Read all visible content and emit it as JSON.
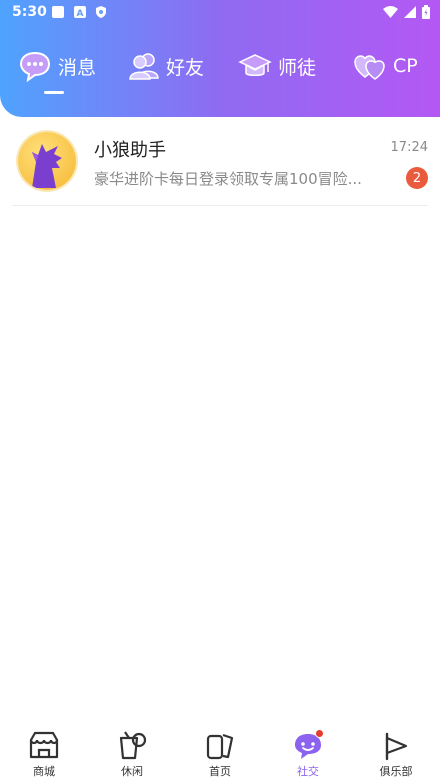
{
  "status_bar": {
    "time": "5:30"
  },
  "top_tabs": [
    {
      "label": "消息",
      "icon": "chat-bubble-icon",
      "active": true
    },
    {
      "label": "好友",
      "icon": "friends-icon",
      "active": false
    },
    {
      "label": "师徒",
      "icon": "graduation-cap-icon",
      "active": false
    },
    {
      "label": "CP",
      "icon": "hearts-icon",
      "active": false
    }
  ],
  "messages": [
    {
      "name": "小狼助手",
      "time": "17:24",
      "preview": "豪华进阶卡每日登录领取专属100冒险...",
      "unread": "2",
      "avatar_icon": "wolf-icon"
    }
  ],
  "bottom_nav": [
    {
      "label": "商城",
      "icon": "store-icon"
    },
    {
      "label": "休闲",
      "icon": "cup-icon"
    },
    {
      "label": "首页",
      "icon": "home-cards-icon"
    },
    {
      "label": "社交",
      "icon": "social-chat-icon",
      "active": true
    },
    {
      "label": "俱乐部",
      "icon": "flag-icon"
    }
  ],
  "colors": {
    "accent": "#8c63ee",
    "badge": "#ea5a3d",
    "gradient_start": "#4fa3ff",
    "gradient_end": "#b458f4"
  }
}
